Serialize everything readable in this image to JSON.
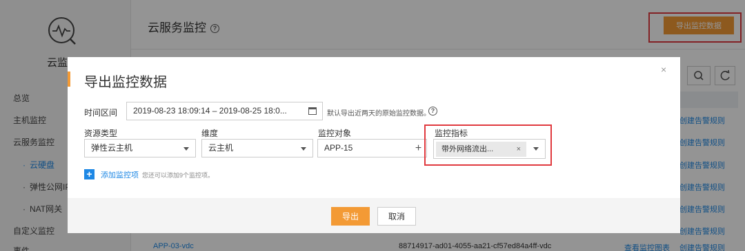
{
  "sidebar": {
    "title": "云监",
    "items": [
      {
        "label": "总览",
        "sub": false
      },
      {
        "label": "主机监控",
        "sub": false
      },
      {
        "label": "云服务监控",
        "sub": false
      },
      {
        "label": "云硬盘",
        "sub": true,
        "active": true
      },
      {
        "label": "弹性公网IP",
        "sub": true
      },
      {
        "label": "NAT网关",
        "sub": true
      },
      {
        "label": "自定义监控",
        "sub": false
      },
      {
        "label": "事件",
        "sub": false
      }
    ]
  },
  "header": {
    "title": "云服务监控",
    "help": "?",
    "export_button": "导出监控数据"
  },
  "table": {
    "rule_link": "创建告警规则",
    "row_name": "APP-03-vdc",
    "row_id": "88714917-ad01-4055-aa21-cf57ed84a4ff-vdc",
    "row_action": "查看监控图表"
  },
  "modal": {
    "title": "导出监控数据",
    "close": "×",
    "time_range": {
      "label": "时间区间",
      "value": "2019-08-23 18:09:14 – 2019-08-25 18:0...",
      "hint": "默认导出近两天的原始监控数据。"
    },
    "resource_type": {
      "label": "资源类型",
      "value": "弹性云主机"
    },
    "dimension": {
      "label": "维度",
      "value": "云主机"
    },
    "monitor_object": {
      "label": "监控对象",
      "value": "APP-15",
      "add": "+"
    },
    "metric": {
      "label": "监控指标",
      "tag": "带外网络流出...",
      "remove": "×"
    },
    "add_item": {
      "label": "添加监控项",
      "hint": "您还可以添加9个监控项。"
    },
    "buttons": {
      "export": "导出",
      "cancel": "取消"
    }
  },
  "colors": {
    "accent": "#f39a35",
    "link": "#1e88e5",
    "highlight": "#e0393e"
  }
}
